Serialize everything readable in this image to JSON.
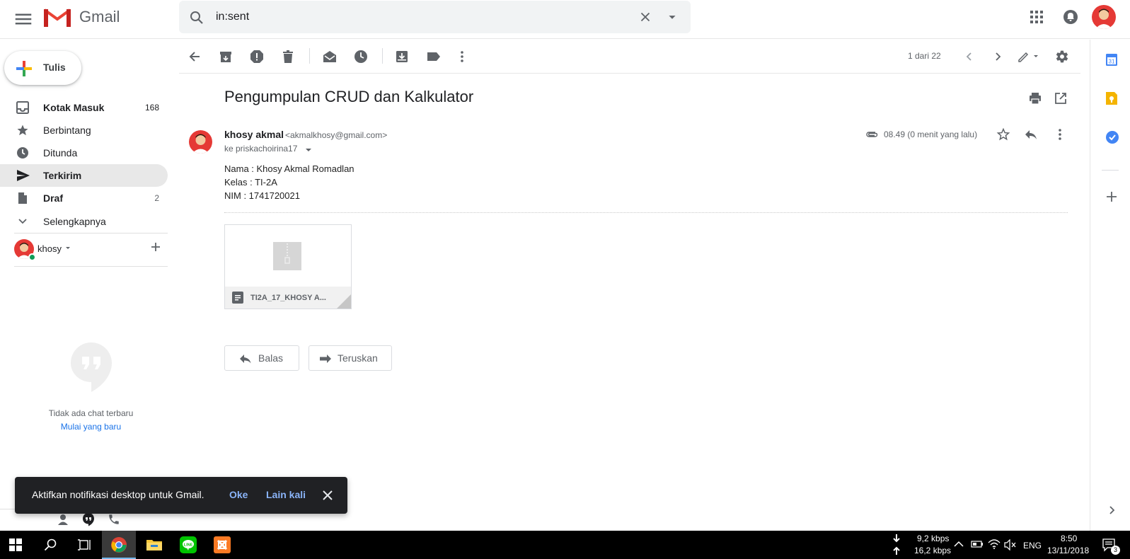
{
  "app": {
    "name": "Gmail"
  },
  "search": {
    "value": "in:sent"
  },
  "sidebar": {
    "compose_label": "Tulis",
    "items": [
      {
        "label": "Kotak Masuk",
        "count": "168",
        "bold": true
      },
      {
        "label": "Berbintang",
        "count": "",
        "bold": false
      },
      {
        "label": "Ditunda",
        "count": "",
        "bold": false
      },
      {
        "label": "Terkirim",
        "count": "",
        "bold": true,
        "active": true
      },
      {
        "label": "Draf",
        "count": "2",
        "bold": true
      },
      {
        "label": "Selengkapnya",
        "count": "",
        "bold": false
      }
    ],
    "hangouts_user": "khosy",
    "no_chat_text": "Tidak ada chat terbaru",
    "start_new_link": "Mulai yang baru"
  },
  "toolbar": {
    "page_count": "1 dari 22"
  },
  "message": {
    "subject": "Pengumpulan CRUD dan Kalkulator",
    "sender_name": "khosy akmal",
    "sender_email": "<akmalkhosy@gmail.com>",
    "recipient": "ke priskachoirina17",
    "time": "08.49 (0 menit yang lalu)",
    "body": [
      "Nama : Khosy Akmal Romadlan",
      "Kelas : TI-2A",
      "NIM : 1741720021"
    ],
    "attachment_name": "TI2A_17_KHOSY A..."
  },
  "actions": {
    "reply": "Balas",
    "forward": "Teruskan"
  },
  "snackbar": {
    "text": "Aktifkan notifikasi desktop untuk Gmail.",
    "ok": "Oke",
    "later": "Lain kali"
  },
  "taskbar": {
    "download_speed": "9,2 kbps",
    "upload_speed": "16,2 kbps",
    "language": "ENG",
    "time": "8:50",
    "date": "13/11/2018",
    "notification_count": "3"
  },
  "colors": {
    "gmail_red": "#ea4335",
    "link_blue": "#1a73e8",
    "snackbar_link": "#8ab4f8",
    "active_nav": "#e8e8e8"
  }
}
